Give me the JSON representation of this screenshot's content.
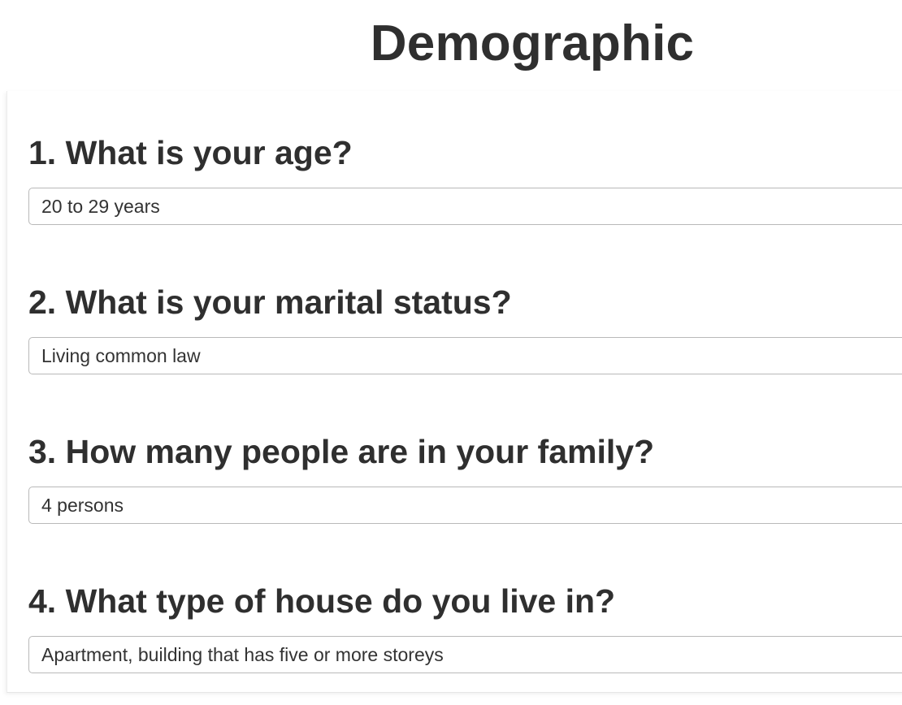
{
  "page": {
    "title": "Demographic"
  },
  "questions": [
    {
      "label": "1. What is your age?",
      "selected_value": "20 to 29 years"
    },
    {
      "label": "2. What is your marital status?",
      "selected_value": "Living common law"
    },
    {
      "label": "3. How many people are in your family?",
      "selected_value": "4 persons"
    },
    {
      "label": "4. What type of house do you live in?",
      "selected_value": "Apartment, building that has five or more storeys"
    }
  ]
}
